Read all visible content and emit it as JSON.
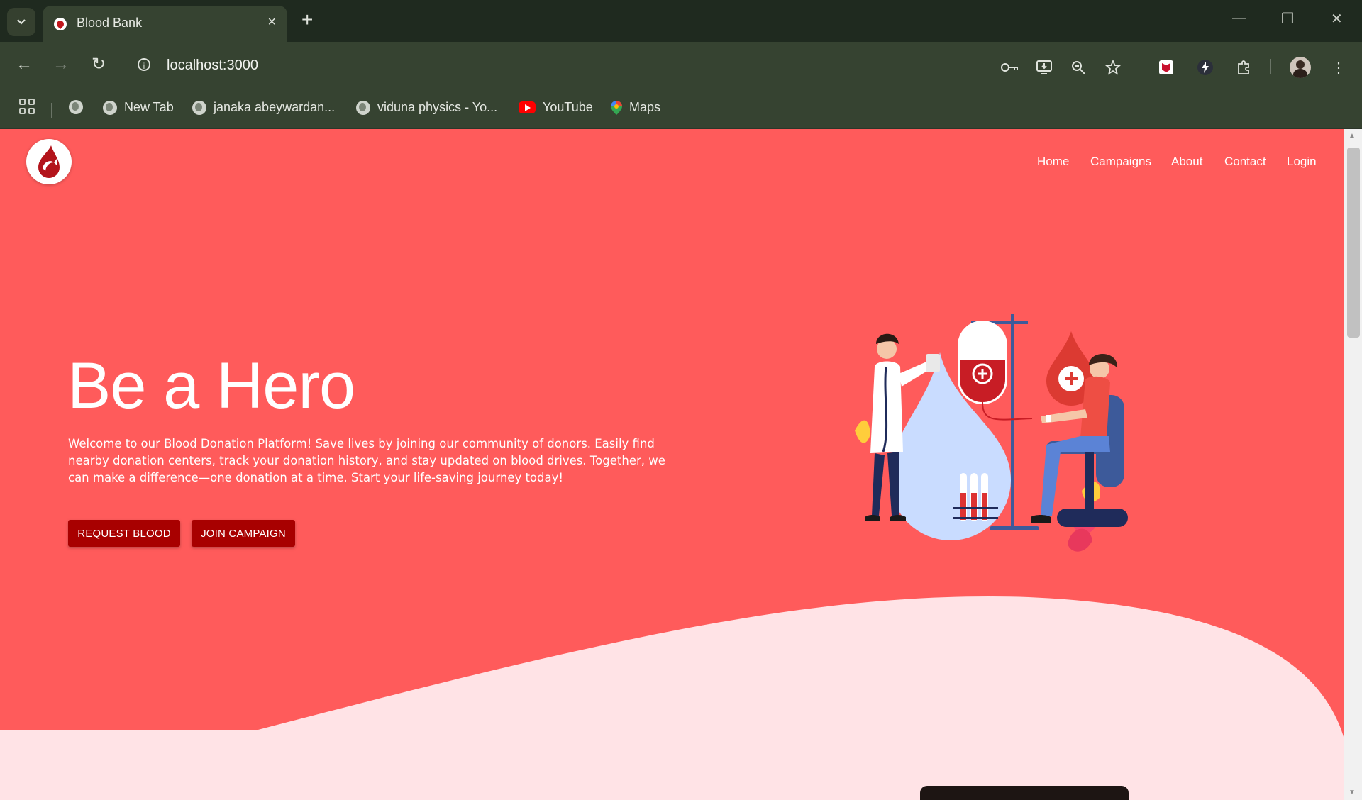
{
  "browser": {
    "tab": {
      "title": "Blood Bank"
    },
    "address": {
      "url": "localhost:3000"
    },
    "bookmarks": [
      {
        "label": "New Tab",
        "icon": "globe-icon"
      },
      {
        "label": "janaka abeywardan...",
        "icon": "globe-icon"
      },
      {
        "label": "viduna physics - Yo...",
        "icon": "globe-icon"
      },
      {
        "label": "YouTube",
        "icon": "youtube-icon"
      },
      {
        "label": "Maps",
        "icon": "maps-icon"
      }
    ],
    "icons": {
      "close_tab": "×",
      "new_tab": "+",
      "back": "←",
      "forward": "→",
      "reload": "↻",
      "minimize": "—",
      "restore": "❐",
      "close_window": "✕",
      "menu": "⋮"
    }
  },
  "page": {
    "nav": [
      "Home",
      "Campaigns",
      "About",
      "Contact",
      "Login"
    ],
    "hero": {
      "title": "Be a Hero",
      "description": "Welcome to our Blood Donation Platform! Save lives by joining our community of donors. Easily find nearby donation centers, track your donation history, and stay updated on blood drives. Together, we can make a difference—one donation at a time. Start your life-saving journey today!",
      "primary_button": "REQUEST BLOOD",
      "secondary_button": "JOIN CAMPAIGN"
    },
    "colors": {
      "hero_bg": "#ff5b5b",
      "wave": "#ffe3e6",
      "button": "#a80000",
      "brand_red": "#c0161c"
    }
  }
}
